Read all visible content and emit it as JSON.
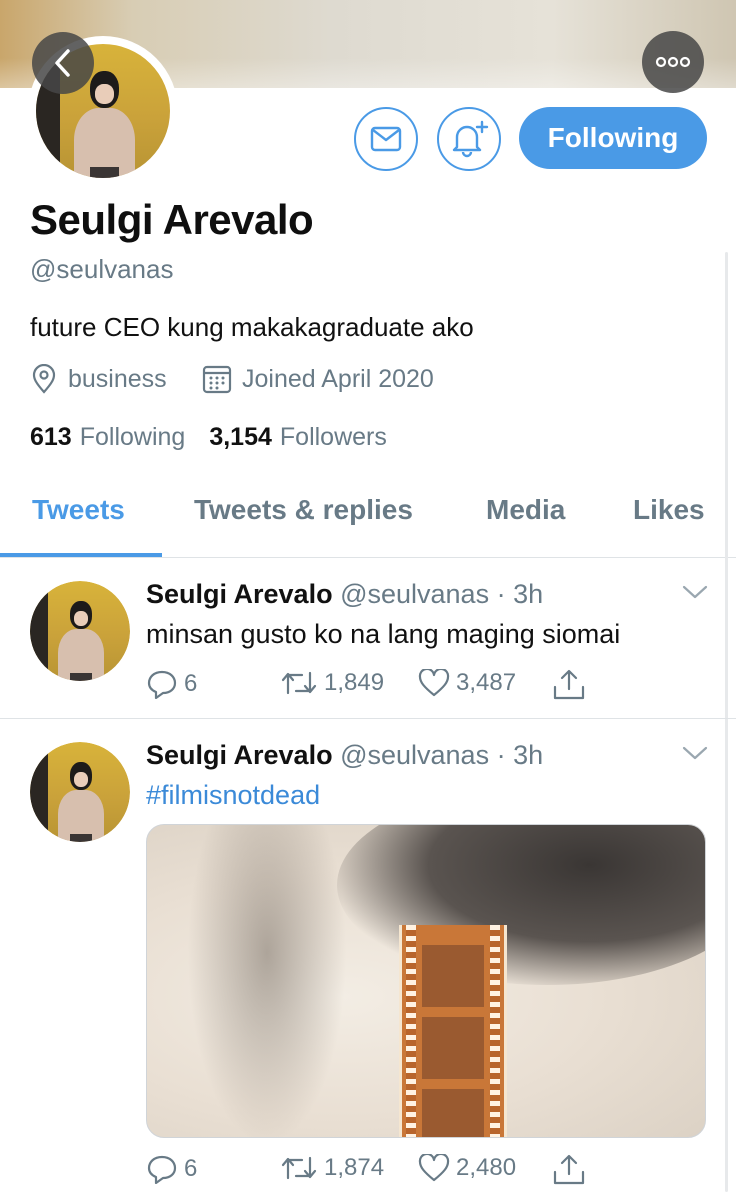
{
  "profile": {
    "name": "Seulgi Arevalo",
    "handle": "@seulvanas",
    "bio": "future CEO kung makakagraduate ako",
    "location": "business",
    "joined": "Joined April 2020",
    "following_count": "613",
    "following_label": "Following",
    "followers_count": "3,154",
    "followers_label": "Followers",
    "follow_button_label": "Following"
  },
  "tabs": [
    {
      "label": "Tweets",
      "active": true
    },
    {
      "label": "Tweets & replies",
      "active": false
    },
    {
      "label": "Media",
      "active": false
    },
    {
      "label": "Likes",
      "active": false
    }
  ],
  "tweets": [
    {
      "name": "Seulgi Arevalo",
      "handle": "@seulvanas",
      "time": "3h",
      "text": "minsan gusto ko na lang maging siomai",
      "replies": "6",
      "retweets": "1,849",
      "likes": "3,487"
    },
    {
      "name": "Seulgi Arevalo",
      "handle": "@seulvanas",
      "time": "3h",
      "text": "#filmisnotdead",
      "replies": "6",
      "retweets": "1,874",
      "likes": "2,480"
    }
  ],
  "colors": {
    "accent": "#4a9ae6",
    "secondary_text": "#687a86"
  },
  "icons": [
    "back-arrow-icon",
    "more-options-icon",
    "mail-icon",
    "bell-plus-icon",
    "location-pin-icon",
    "calendar-icon",
    "reply-icon",
    "retweet-icon",
    "like-icon",
    "share-icon",
    "chevron-down-icon"
  ]
}
